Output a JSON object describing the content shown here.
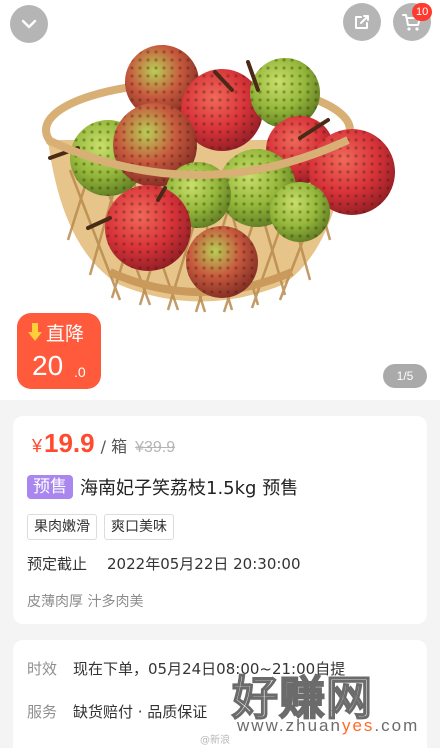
{
  "header": {
    "back_icon": "chevron-down-icon",
    "share_icon": "share-icon",
    "cart_icon": "cart-icon",
    "cart_badge": "10"
  },
  "hero": {
    "image": "lychee-basket-photo",
    "price_drop": {
      "label": "直降",
      "amount_int": "20",
      "amount_dec": ".0",
      "color": "#ff5a3c"
    },
    "pager": "1/5"
  },
  "product": {
    "currency": "¥",
    "price": "19.9",
    "unit": "/ 箱",
    "original_price": "¥39.9",
    "presale_tag": "预售",
    "title": "海南妃子笑荔枝1.5kg 预售",
    "tags": [
      "果肉嫩滑",
      "爽口美味"
    ],
    "deadline_label": "预定截止",
    "deadline_value": "2022年05月22日 20:30:00",
    "description": "皮薄肉厚 汁多肉美",
    "price_color": "#ff4a2e",
    "tag_color": "#a987ef"
  },
  "service": {
    "rows": [
      {
        "key": "时效",
        "value": "现在下单，05月24日08:00~21:00自提"
      },
      {
        "key": "服务",
        "value": "缺货赔付 · 品质保证"
      }
    ]
  },
  "watermark": {
    "brand": "好赚网",
    "url_prefix": "www.zhuan",
    "url_highlight": "yes",
    "url_suffix": ".com",
    "weibo": "@新浪"
  }
}
